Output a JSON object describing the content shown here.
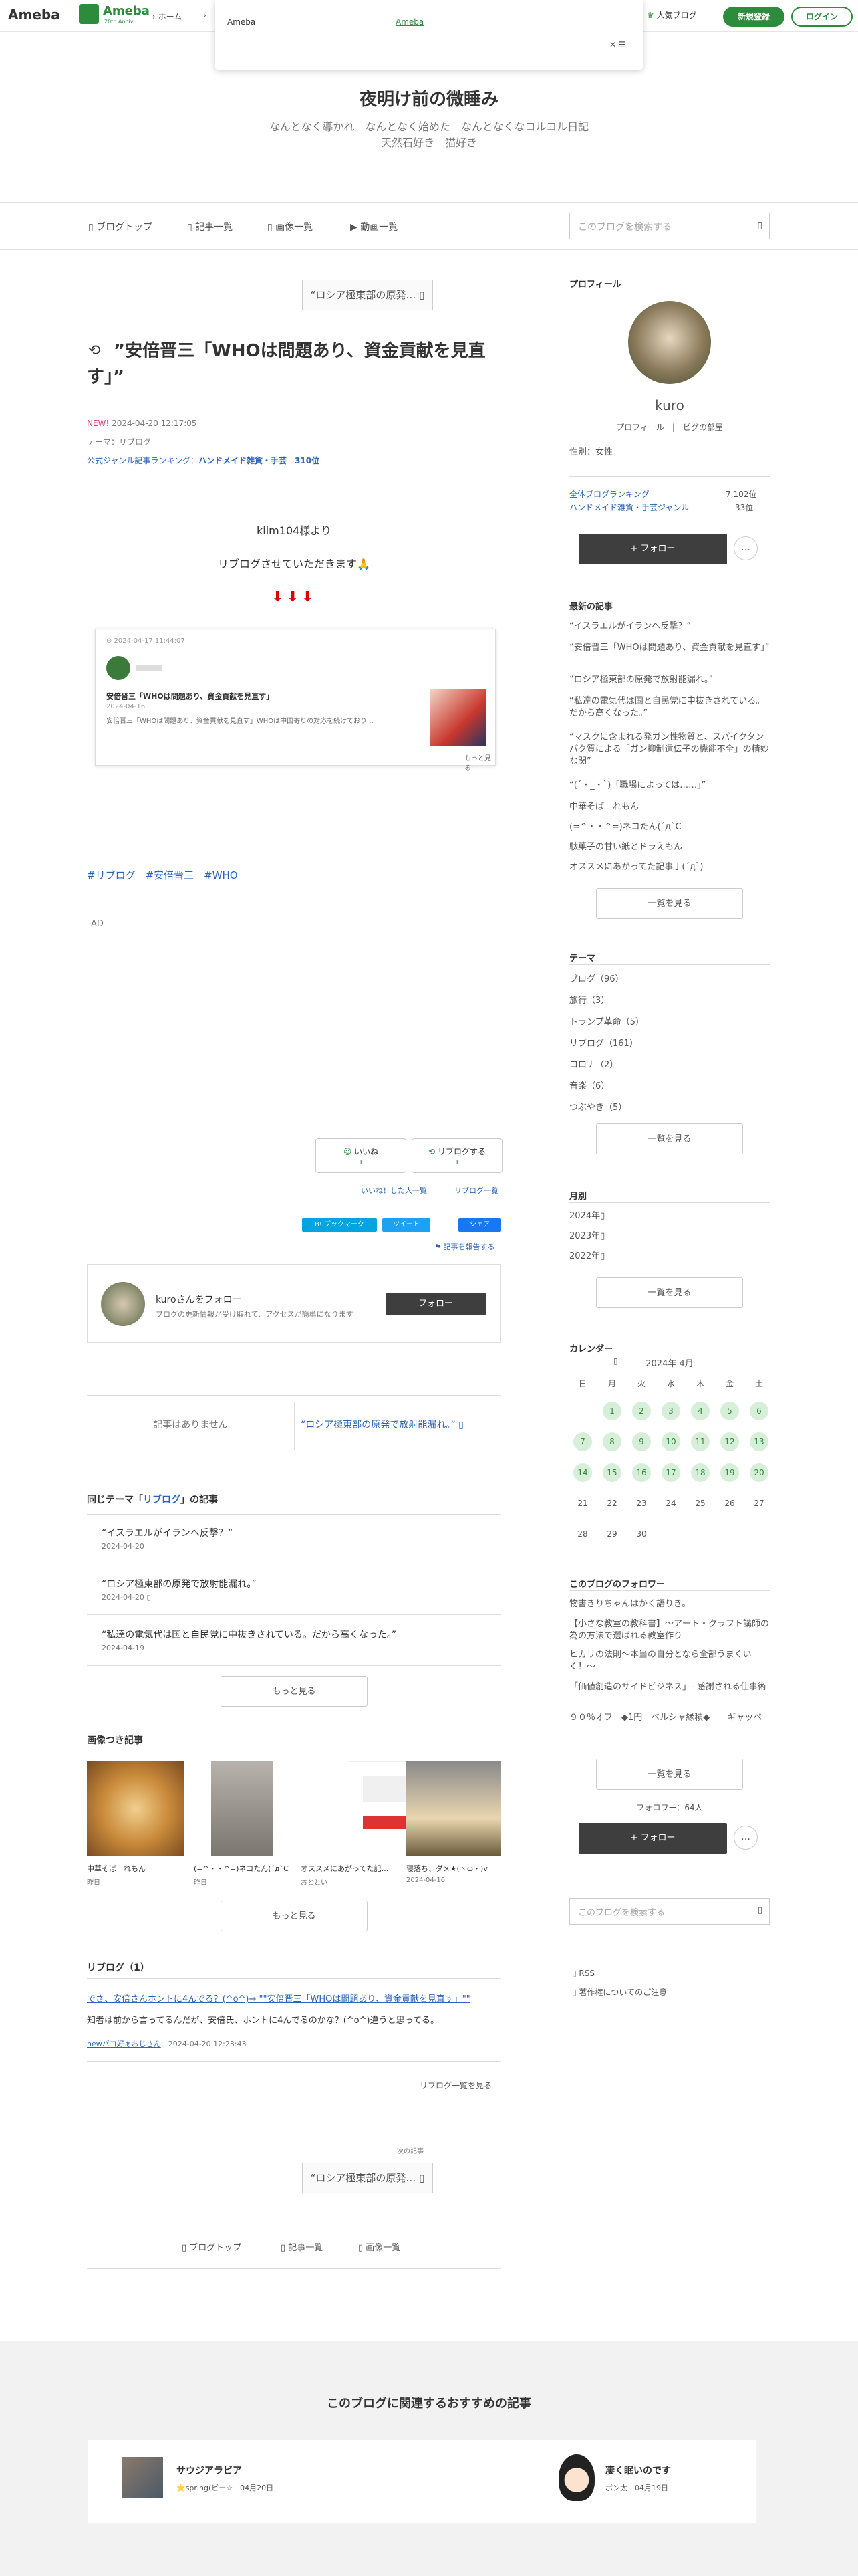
{
  "header": {
    "logo": "Ameba",
    "anniv_logo": "Ameba",
    "anniv_sub": "20th Anniv.",
    "home": "ホーム",
    "popular": "人気ブログ",
    "signup": "新規登録",
    "login": "ログイン"
  },
  "popup": {
    "title": "Ameba",
    "link": "Ameba",
    "close": "✕"
  },
  "blog": {
    "title": "夜明け前の微睡み",
    "desc1": "なんとなく導かれ　なんとなく始めた　なんとなくなコルコル日記",
    "desc2": "天然石好き　猫好き"
  },
  "nav": {
    "top": "ブログトップ",
    "articles": "記事一覧",
    "images": "画像一覧",
    "videos": "動画一覧",
    "search_placeholder": "このブログを検索する"
  },
  "article": {
    "prev_top": "“ロシア極東部の原発…",
    "title": "”安倍晋三「WHOは問題あり、資金貢献を見直す」”",
    "new_label": "NEW!",
    "date": "2024-04-20 12:17:05",
    "theme": "テーマ：リブログ",
    "rank_label": "公式ジャンル記事ランキング：",
    "rank_genre": "ハンドメイド雑貨・手芸",
    "rank_pos": "310位",
    "body1": "kiim104様より",
    "body2": "リブログさせていただきます🙏",
    "arrows": "⬇⬇⬇",
    "embed_head": "⊙ 2024-04-17 11:44:07",
    "embed_title": "安倍晋三「WHOは問題あり、資金貢献を見直す」",
    "embed_date": "2024-04-16",
    "embed_text": "安倍晋三「WHOは問題あり、資金貢献を見直す」WHOは中国寄りの対応を続けており…",
    "embed_more": "もっと見る",
    "hashtags": "#リブログ　#安倍晋三　#WHO",
    "ad": "AD",
    "like": "いいね",
    "like_count": "1",
    "reblog": "リブログする",
    "reblog_count": "1",
    "liked_users": "いいね！した人一覧",
    "reblog_list": "リブログ一覧",
    "hatena": "B! ブックマーク",
    "tweet": "ツイート",
    "fb": "シェア",
    "report": "記事を報告する",
    "follow_name": "kuroさんをフォロー",
    "follow_desc": "ブログの更新情報が受け取れて、アクセスが簡単になります",
    "follow_btn": "フォロー",
    "no_prev": "記事はありません",
    "next_article": "“ロシア極東部の原発で放射能漏れ。”",
    "same_theme_prefix": "同じテーマ「",
    "same_theme_name": "リブログ",
    "same_theme_suffix": "」の記事",
    "same_items": [
      {
        "title": "“イスラエルがイランへ反撃？”",
        "date": "2024-04-20"
      },
      {
        "title": "“ロシア極東部の原発で放射能漏れ。”",
        "date": "2024-04-20"
      },
      {
        "title": "“私達の電気代は国と自民党に中抜きされている。だから高くなった。”",
        "date": "2024-04-19"
      }
    ],
    "more_btn": "もっと見る",
    "image_articles_title": "画像つき記事",
    "image_articles": [
      {
        "title": "中華そば　れもん",
        "date": "昨日"
      },
      {
        "title": "(=^・・^=)ネコたん(´д`C",
        "date": "昨日"
      },
      {
        "title": "オススメにあがってた記…",
        "date": "おととい"
      },
      {
        "title": "寝落ち、ダメ★(ヽω・)v",
        "date": "2024-04-16"
      }
    ],
    "more_btn2": "もっと見る",
    "reblog_section_title": "リブログ（1）",
    "reblog_link": "でさ、安倍さんホントに4んでる？(^o^)→ \"\"安倍晋三「WHOは問題あり、資金貢献を見直す」\"\"",
    "reblog_text": "知者は前から言ってるんだが、安倍氏、ホントに4んでるのかな？(^o^)違うと思ってる。",
    "reblog_user": "newバコ好ぁおじさん",
    "reblog_date": "2024-04-20 12:23:43",
    "reblog_more": "リブログ一覧を見る",
    "next_label": "次の記事",
    "next_btn": "“ロシア極東部の原発…",
    "bottom_top": "ブログトップ",
    "bottom_articles": "記事一覧",
    "bottom_images": "画像一覧"
  },
  "sidebar": {
    "profile_h": "プロフィール",
    "name": "kuro",
    "profile_link": "プロフィール",
    "room_link": "ピグの部屋",
    "gender": "性別：女性",
    "rank_all_label": "全体ブログランキング",
    "rank_all_val": "7,102位",
    "rank_genre_label": "ハンドメイド雑貨・手芸ジャンル",
    "rank_genre_val": "33位",
    "follow": "+ フォロー",
    "more": "…",
    "latest_h": "最新の記事",
    "latest": [
      "“イスラエルがイランへ反撃？”",
      "“安倍晋三「WHOは問題あり、資金貢献を見直す」”",
      "“ロシア極東部の原発で放射能漏れ。”",
      "“私達の電気代は国と自民党に中抜きされている。だから高くなった。”",
      "“マスクに含まれる発ガン性物質と、スパイクタンパク質による「ガン抑制遺伝子の機能不全」の精妙な関”",
      "“(´・_・`)「職場によっては……」”",
      "中華そば　れもん",
      "(=^・・^=)ネコたん(´д`C",
      "駄菓子の甘い紙とドラえもん",
      "オススメにあがってた記事丁(´д`)"
    ],
    "latest_more": "一覧を見る",
    "theme_h": "テーマ",
    "themes": [
      "ブログ（96）",
      "旅行（3）",
      "トランプ革命（5）",
      "リブログ（161）",
      "コロナ（2）",
      "音楽（6）",
      "つぶやき（5）"
    ],
    "theme_more": "一覧を見る",
    "month_h": "月別",
    "months": [
      "2024年",
      "2023年",
      "2022年"
    ],
    "month_more": "一覧を見る",
    "cal_h": "カレンダー",
    "cal_month": "2024年 4月",
    "weekdays": [
      "日",
      "月",
      "火",
      "水",
      "木",
      "金",
      "土"
    ],
    "followers_h": "このブログのフォロワー",
    "followers": [
      "物書きりちゃんはかく語りき。",
      "【小さな教室の教科書】〜アート・クラフト講師の為の方法で選ばれる教室作り",
      "ヒカリの法則〜本当の自分となら全部うまくいく！〜",
      "「価値創造のサイドビジネス」- 感謝される仕事術",
      "９０％オフ　◆1円　ベルシャ縁積◆　　ギャッペ"
    ],
    "followers_more": "一覧を見る",
    "follower_count": "フォロワー：64人",
    "follow2": "+ フォロー",
    "search_placeholder": "このブログを検索する",
    "rss": "RSS",
    "copyright": "著作権についてのご注意"
  },
  "recommend": {
    "title": "このブログに関連するおすすめの記事",
    "items": [
      {
        "title": "サウジアラビア",
        "user": "⭐spring(ビー☆",
        "date": "04月20日"
      },
      {
        "title": "凄く眠いのです",
        "user": "ボン太",
        "date": "04月19日"
      }
    ]
  }
}
